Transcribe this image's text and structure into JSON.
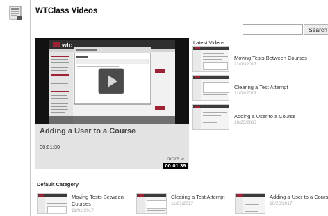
{
  "page": {
    "title": "WTClass Videos"
  },
  "search": {
    "placeholder": "",
    "value": "",
    "button_label": "Search"
  },
  "featured": {
    "title": "Adding a User to a Course",
    "time": "00:01:39",
    "more_label": "more »",
    "duration_badge": "00:01:39",
    "preview_logo_text": "wtc"
  },
  "latest": {
    "heading": "Latest Videos:",
    "items": [
      {
        "title": "Moving Tests Between Courses",
        "date": "11/01/2017"
      },
      {
        "title": "Clearing a Test Attempt",
        "date": "11/01/2017"
      },
      {
        "title": "Adding a User to a Course",
        "date": "10/25/2017"
      }
    ]
  },
  "category": {
    "heading": "Default Category",
    "items": [
      {
        "title": "Moving Tests Between Courses",
        "date": "11/01/2017"
      },
      {
        "title": "Clearing a Test Attempt",
        "date": "11/01/2017"
      },
      {
        "title": "Adding a User to a Course",
        "date": "10/25/2017"
      }
    ]
  },
  "colors": {
    "accent": "#9d2235",
    "player_bg": "#e3e3e3",
    "badge_bg": "#000000"
  }
}
